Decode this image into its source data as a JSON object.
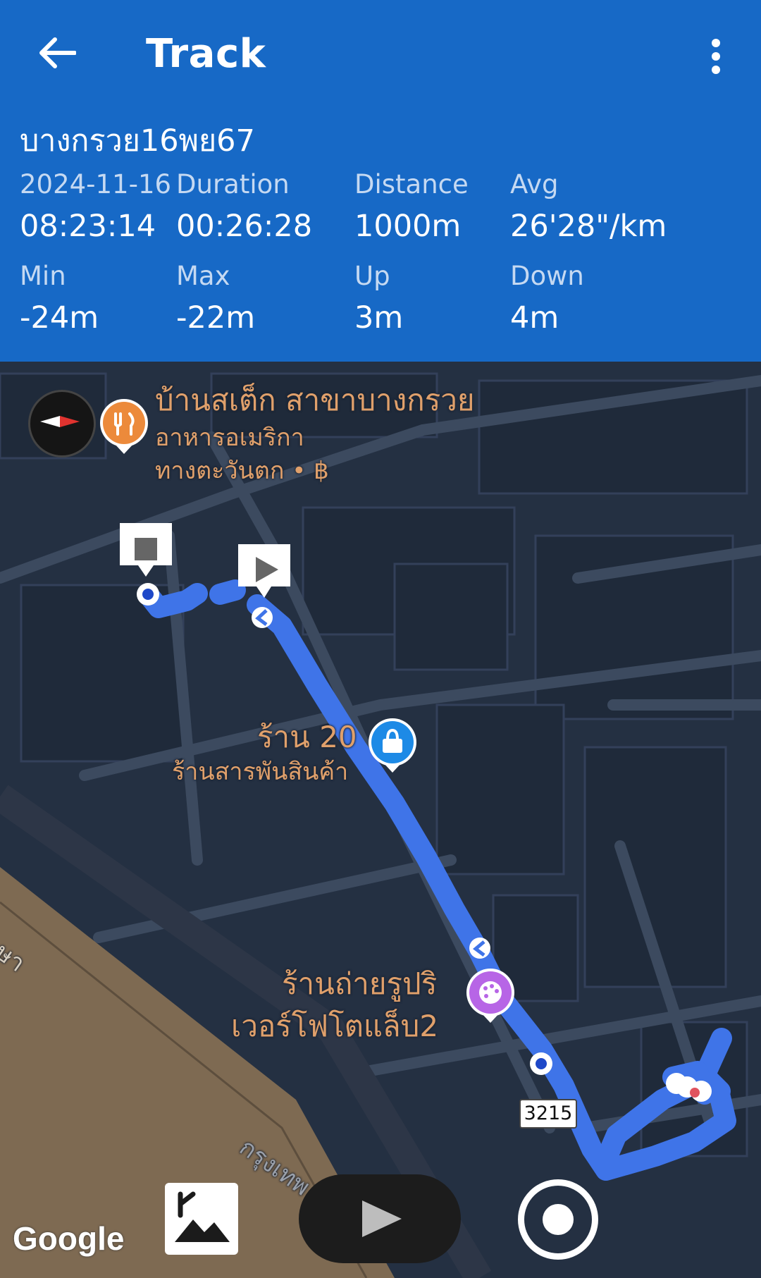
{
  "header": {
    "title": "Track",
    "track_name": "บางกรวย16พย67",
    "date": "2024-11-16",
    "time": "08:23:14",
    "stats": {
      "duration": {
        "label": "Duration",
        "value": "00:26:28"
      },
      "distance": {
        "label": "Distance",
        "value": "1000m"
      },
      "avg": {
        "label": "Avg",
        "value": "26'28\"/km"
      },
      "min": {
        "label": "Min",
        "value": "-24m"
      },
      "max": {
        "label": "Max",
        "value": "-22m"
      },
      "up": {
        "label": "Up",
        "value": "3m"
      },
      "down": {
        "label": "Down",
        "value": "4m"
      }
    }
  },
  "map": {
    "poi_restaurant": {
      "name": "บ้านสเต็ก สาขาบางกรวย",
      "line2": "อาหารอเมริกา",
      "line3": "ทางตะวันตก • ฿"
    },
    "poi_store": {
      "name": "ร้าน 20",
      "category": "ร้านสารพันสินค้า"
    },
    "poi_photo": {
      "line1": "ร้านถ่ายรูปริ",
      "line2": "เวอร์โฟโตแล็บ2"
    },
    "road_left": "ษา",
    "road_bottom": "กรุงเทพ นนท",
    "road_number": "3215",
    "attribution": "Google",
    "colors": {
      "track": "#3f74e8",
      "header": "#1769c6",
      "poi_label": "#e0a06b"
    }
  }
}
